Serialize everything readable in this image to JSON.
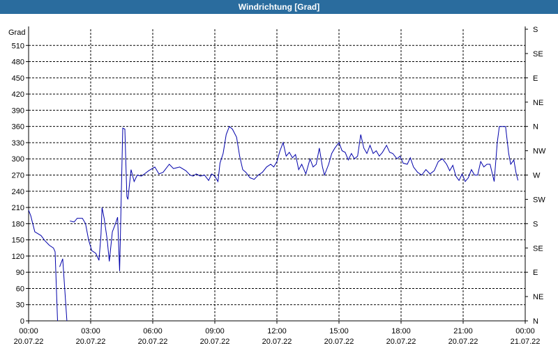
{
  "window": {
    "title": "Windrichtung [Grad]"
  },
  "colors": {
    "titlebar": "#2a6c9e",
    "line": "#0000aa",
    "grid": "#000000"
  },
  "chart_data": {
    "type": "line",
    "title": "Windrichtung [Grad]",
    "ylabel": "Grad",
    "ylim": [
      0,
      540
    ],
    "yticks": [
      0,
      30,
      60,
      90,
      120,
      150,
      180,
      210,
      240,
      270,
      300,
      330,
      360,
      390,
      420,
      450,
      480,
      510
    ],
    "y2ticks": [
      {
        "v": 0,
        "label": "N"
      },
      {
        "v": 45,
        "label": "NE"
      },
      {
        "v": 90,
        "label": "E"
      },
      {
        "v": 135,
        "label": "SE"
      },
      {
        "v": 180,
        "label": "S"
      },
      {
        "v": 225,
        "label": "SW"
      },
      {
        "v": 270,
        "label": "W"
      },
      {
        "v": 315,
        "label": "NW"
      },
      {
        "v": 360,
        "label": "N"
      },
      {
        "v": 405,
        "label": "NE"
      },
      {
        "v": 450,
        "label": "E"
      },
      {
        "v": 495,
        "label": "SE"
      },
      {
        "v": 540,
        "label": "S"
      }
    ],
    "xlim": [
      0,
      24
    ],
    "xticks": [
      {
        "h": 0,
        "time": "00:00",
        "date": "20.07.22"
      },
      {
        "h": 3,
        "time": "03:00",
        "date": "20.07.22"
      },
      {
        "h": 6,
        "time": "06:00",
        "date": "20.07.22"
      },
      {
        "h": 9,
        "time": "09:00",
        "date": "20.07.22"
      },
      {
        "h": 12,
        "time": "12:00",
        "date": "20.07.22"
      },
      {
        "h": 15,
        "time": "15:00",
        "date": "20.07.22"
      },
      {
        "h": 18,
        "time": "18:00",
        "date": "20.07.22"
      },
      {
        "h": 21,
        "time": "21:00",
        "date": "20.07.22"
      },
      {
        "h": 24,
        "time": "00:00",
        "date": "21.07.22"
      }
    ],
    "grid": true,
    "series": [
      {
        "segments": [
          [
            [
              0,
              205
            ],
            [
              0.1,
              195
            ],
            [
              0.3,
              165
            ],
            [
              0.6,
              158
            ],
            [
              0.8,
              148
            ],
            [
              1.0,
              140
            ],
            [
              1.2,
              135
            ],
            [
              1.28,
              128
            ],
            [
              1.4,
              0
            ]
          ],
          [
            [
              1.5,
              100
            ],
            [
              1.65,
              115
            ],
            [
              1.85,
              0
            ]
          ],
          [
            [
              2.0,
              185
            ],
            [
              2.2,
              183
            ],
            [
              2.35,
              190
            ],
            [
              2.6,
              190
            ],
            [
              2.75,
              180
            ],
            [
              2.9,
              150
            ],
            [
              3.05,
              130
            ],
            [
              3.25,
              125
            ],
            [
              3.4,
              112
            ],
            [
              3.5,
              160
            ],
            [
              3.55,
              210
            ],
            [
              3.65,
              190
            ],
            [
              3.8,
              150
            ],
            [
              3.9,
              110
            ],
            [
              4.05,
              165
            ],
            [
              4.2,
              180
            ],
            [
              4.3,
              192
            ],
            [
              4.4,
              92
            ],
            [
              4.5,
              270
            ],
            [
              4.55,
              357
            ],
            [
              4.65,
              355
            ],
            [
              4.75,
              230
            ],
            [
              4.8,
              225
            ],
            [
              4.95,
              280
            ],
            [
              5.1,
              258
            ],
            [
              5.25,
              270
            ],
            [
              5.45,
              268
            ],
            [
              5.6,
              272
            ],
            [
              5.8,
              278
            ],
            [
              6.1,
              285
            ],
            [
              6.3,
              272
            ],
            [
              6.5,
              275
            ],
            [
              6.8,
              290
            ],
            [
              7.0,
              282
            ],
            [
              7.3,
              285
            ],
            [
              7.6,
              278
            ],
            [
              7.8,
              270
            ],
            [
              7.95,
              268
            ],
            [
              8.1,
              272
            ],
            [
              8.3,
              268
            ],
            [
              8.5,
              270
            ],
            [
              8.7,
              260
            ],
            [
              8.85,
              272
            ],
            [
              9.0,
              268
            ],
            [
              9.15,
              258
            ],
            [
              9.25,
              292
            ],
            [
              9.4,
              310
            ],
            [
              9.55,
              345
            ],
            [
              9.7,
              360
            ],
            [
              9.85,
              355
            ],
            [
              10.05,
              340
            ],
            [
              10.2,
              305
            ],
            [
              10.35,
              280
            ],
            [
              10.5,
              275
            ],
            [
              10.7,
              265
            ],
            [
              10.9,
              262
            ],
            [
              11.1,
              270
            ],
            [
              11.3,
              275
            ],
            [
              11.5,
              285
            ],
            [
              11.7,
              290
            ],
            [
              11.85,
              285
            ],
            [
              12.0,
              295
            ],
            [
              12.15,
              315
            ],
            [
              12.3,
              330
            ],
            [
              12.45,
              305
            ],
            [
              12.6,
              312
            ],
            [
              12.75,
              302
            ],
            [
              12.9,
              308
            ],
            [
              13.05,
              280
            ],
            [
              13.2,
              290
            ],
            [
              13.4,
              272
            ],
            [
              13.6,
              300
            ],
            [
              13.75,
              285
            ],
            [
              13.9,
              290
            ],
            [
              14.05,
              320
            ],
            [
              14.2,
              285
            ],
            [
              14.3,
              270
            ],
            [
              14.5,
              290
            ],
            [
              14.65,
              310
            ],
            [
              14.8,
              320
            ],
            [
              15.0,
              330
            ],
            [
              15.15,
              315
            ],
            [
              15.3,
              312
            ],
            [
              15.45,
              298
            ],
            [
              15.6,
              310
            ],
            [
              15.75,
              300
            ],
            [
              15.9,
              305
            ],
            [
              16.05,
              345
            ],
            [
              16.2,
              320
            ],
            [
              16.35,
              310
            ],
            [
              16.5,
              325
            ],
            [
              16.65,
              310
            ],
            [
              16.8,
              315
            ],
            [
              16.95,
              305
            ],
            [
              17.1,
              312
            ],
            [
              17.3,
              325
            ],
            [
              17.45,
              312
            ],
            [
              17.6,
              310
            ],
            [
              17.8,
              300
            ],
            [
              17.95,
              305
            ],
            [
              18.1,
              292
            ],
            [
              18.3,
              290
            ],
            [
              18.45,
              302
            ],
            [
              18.6,
              285
            ],
            [
              18.8,
              275
            ],
            [
              19.0,
              270
            ],
            [
              19.2,
              280
            ],
            [
              19.4,
              272
            ],
            [
              19.6,
              278
            ],
            [
              19.8,
              295
            ],
            [
              20.0,
              300
            ],
            [
              20.2,
              290
            ],
            [
              20.35,
              278
            ],
            [
              20.5,
              288
            ],
            [
              20.65,
              268
            ],
            [
              20.8,
              260
            ],
            [
              20.95,
              272
            ],
            [
              21.1,
              258
            ],
            [
              21.25,
              265
            ],
            [
              21.4,
              280
            ],
            [
              21.55,
              270
            ],
            [
              21.7,
              270
            ],
            [
              21.85,
              295
            ],
            [
              22.0,
              285
            ],
            [
              22.15,
              290
            ],
            [
              22.3,
              290
            ],
            [
              22.5,
              258
            ],
            [
              22.65,
              330
            ],
            [
              22.75,
              360
            ],
            [
              22.9,
              360
            ],
            [
              23.05,
              360
            ],
            [
              23.2,
              310
            ],
            [
              23.3,
              290
            ],
            [
              23.45,
              298
            ],
            [
              23.55,
              275
            ],
            [
              23.65,
              260
            ]
          ]
        ]
      }
    ]
  }
}
